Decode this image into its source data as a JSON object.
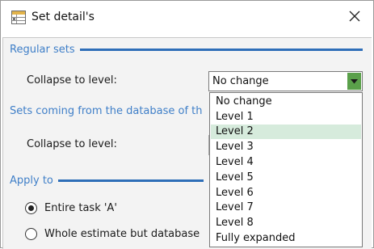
{
  "window": {
    "title": "Set detail's",
    "close_glyph": "✕"
  },
  "regular_sets": {
    "title": "Regular sets",
    "collapse_label": "Collapse to level:",
    "collapse_value": "No change"
  },
  "database_sets": {
    "title": "Sets coming from the database of th",
    "collapse_label": "Collapse to level:"
  },
  "apply_to": {
    "title": "Apply to",
    "options": [
      {
        "label": "Entire task 'A'",
        "checked": true
      },
      {
        "label": "Whole estimate but database",
        "checked": false
      }
    ]
  },
  "dropdown": {
    "items": [
      "No change",
      "Level 1",
      "Level 2",
      "Level 3",
      "Level 4",
      "Level 5",
      "Level 6",
      "Level 7",
      "Level 8",
      "Fully expanded"
    ],
    "hovered_item": "Level 2"
  },
  "colors": {
    "accent_blue": "#3f7fc8",
    "hover_green": "#d6ebdc",
    "dropdown_arrow_green": "#5aa04a"
  }
}
